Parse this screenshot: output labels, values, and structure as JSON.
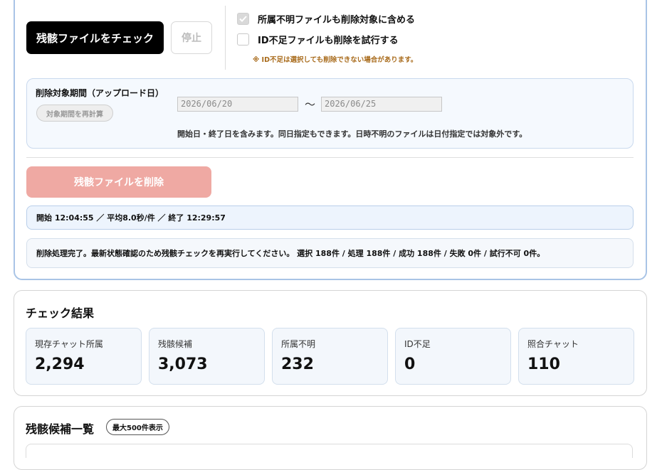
{
  "controls": {
    "check_button": "残骸ファイルをチェック",
    "stop_button": "停止",
    "include_unknown_label": "所属不明ファイルも削除対象に含める",
    "include_unknown_checked": true,
    "try_missing_id_label": "ID不足ファイルも削除を試行する",
    "try_missing_id_checked": false,
    "note": "※ ID不足は選択しても削除できない場合があります。"
  },
  "period": {
    "label": "削除対象期間（アップロード日）",
    "recalc_button": "対象期間を再計算",
    "start_date": "2026/06/20",
    "separator": "〜",
    "end_date": "2026/06/25",
    "help": "開始日・終了日を含みます。同日指定もできます。日時不明のファイルは日付指定では対象外です。"
  },
  "delete_button": "残骸ファイルを削除",
  "timing_text": "開始 12:04:55 ／ 平均8.0秒/件 ／ 終了 12:29:57",
  "result_text": "削除処理完了。最新状態確認のため残骸チェックを再実行してください。 選択 188件 / 処理 188件 / 成功 188件 / 失敗 0件 / 試行不可 0件。",
  "check_results": {
    "title": "チェック結果",
    "stats": [
      {
        "label": "現存チャット所属",
        "value": "2,294"
      },
      {
        "label": "残骸候補",
        "value": "3,073"
      },
      {
        "label": "所属不明",
        "value": "232"
      },
      {
        "label": "ID不足",
        "value": "0"
      },
      {
        "label": "照合チャット",
        "value": "110"
      }
    ]
  },
  "candidate_list": {
    "title": "残骸候補一覧",
    "badge": "最大500件表示"
  },
  "colors": {
    "accent_border": "#a9c4e6",
    "delete_button_disabled": "#efa9a3",
    "note_text": "#a86a1a"
  }
}
